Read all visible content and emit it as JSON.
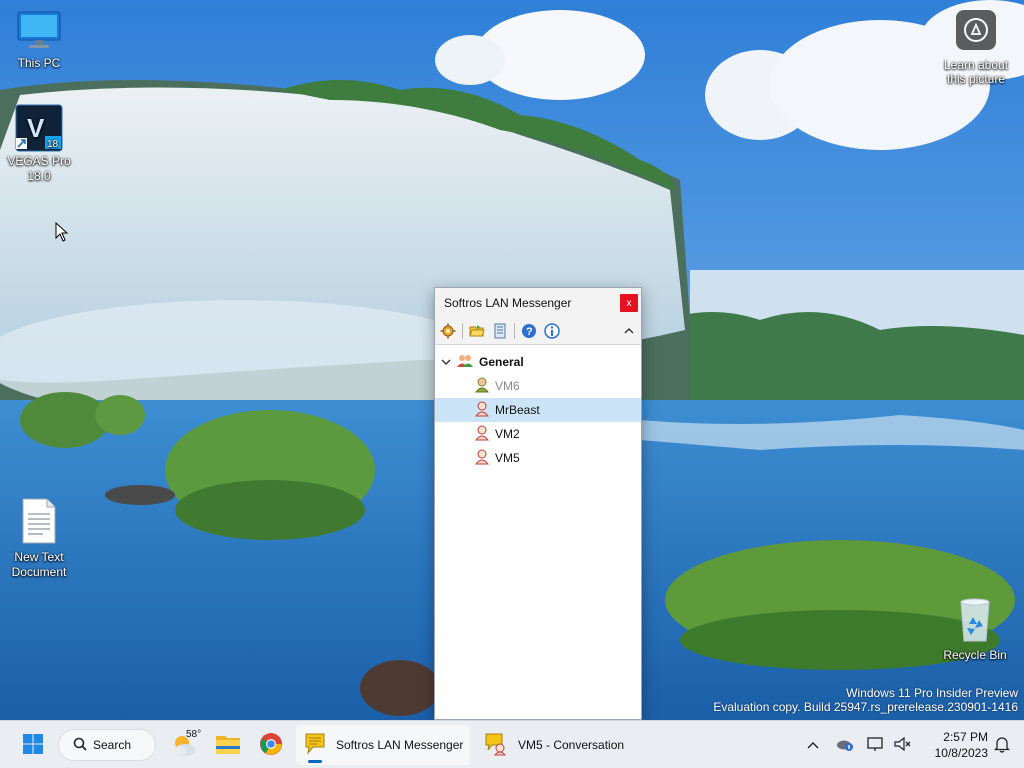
{
  "desktop": {
    "icons": [
      {
        "label": "This PC",
        "icon": "monitor-icon"
      },
      {
        "label": "VEGAS Pro 18.0",
        "badge": "V",
        "version": "18",
        "icon": "vegas-pro-icon"
      },
      {
        "label": "New Text Document",
        "icon": "text-document-icon"
      },
      {
        "label": "Recycle Bin",
        "icon": "recycle-bin-icon"
      }
    ],
    "learn_label": "Learn about this picture",
    "watermark": {
      "line1": "Windows 11 Pro Insider Preview",
      "line2": "Evaluation copy. Build 25947.rs_prerelease.230901-1416"
    }
  },
  "messenger": {
    "title": "Softros LAN Messenger",
    "close_label": "x",
    "toolbar": [
      "settings-gear-icon",
      "open-folder-icon",
      "message-log-icon",
      "help-icon",
      "info-icon"
    ],
    "group": {
      "name": "General",
      "expanded": true
    },
    "users": [
      {
        "name": "VM6",
        "status": "offline",
        "selected": false
      },
      {
        "name": "MrBeast",
        "status": "online",
        "selected": true
      },
      {
        "name": "VM2",
        "status": "online",
        "selected": false
      },
      {
        "name": "VM5",
        "status": "online",
        "selected": false
      }
    ]
  },
  "taskbar": {
    "search_label": "Search",
    "weather_temp": "58°",
    "apps": [
      {
        "label": "Softros LAN Messenger",
        "active": true
      },
      {
        "label": "VM5 - Conversation",
        "active": false
      }
    ],
    "clock": {
      "time": "2:57 PM",
      "date": "10/8/2023"
    }
  },
  "colors": {
    "accent": "#0067c0",
    "close": "#e81123",
    "selected_row": "#cce4f7"
  }
}
